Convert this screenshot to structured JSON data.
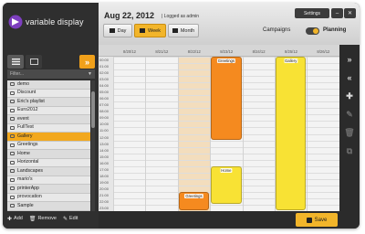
{
  "app": {
    "brand": "variable display",
    "date_title": "Aug 22, 2012",
    "logged_in": "| Logged as admin"
  },
  "window_controls": {
    "settings": "Settings",
    "minimize": "–",
    "close": "✕"
  },
  "sidebar": {
    "collapse_label": "»",
    "filter_placeholder": "Filter...",
    "items": [
      {
        "label": "demo"
      },
      {
        "label": "Discount"
      },
      {
        "label": "Eric's playlist"
      },
      {
        "label": "Euro2012"
      },
      {
        "label": "event"
      },
      {
        "label": "FullTest"
      },
      {
        "label": "Gallery"
      },
      {
        "label": "Greetings"
      },
      {
        "label": "Home"
      },
      {
        "label": "Horizontal"
      },
      {
        "label": "Landscapes"
      },
      {
        "label": "mario's"
      },
      {
        "label": "printerApp"
      },
      {
        "label": "provocation"
      },
      {
        "label": "Sample"
      }
    ],
    "selected_item": "Gallery",
    "actions": {
      "add": "Add",
      "remove": "Remove",
      "edit": "Edit"
    }
  },
  "toolbar": {
    "day": "Day",
    "week": "Week",
    "month": "Month",
    "active_range": "Week",
    "mode_left": "Campaigns",
    "mode_right": "Planning",
    "active_mode": "Planning"
  },
  "calendar": {
    "days": [
      "8/20/12",
      "8/21/12",
      "8/22/12",
      "8/23/12",
      "8/24/12",
      "8/25/12",
      "8/26/12"
    ],
    "today_index": 2,
    "times": [
      "00:00",
      "01:00",
      "02:00",
      "03:00",
      "04:00",
      "05:00",
      "06:00",
      "07:00",
      "08:00",
      "09:00",
      "10:00",
      "11:00",
      "12:00",
      "13:00",
      "14:00",
      "15:00",
      "16:00",
      "17:00",
      "18:00",
      "19:00",
      "20:00",
      "21:00",
      "22:00",
      "23:00"
    ],
    "events": [
      {
        "label": "Greetings",
        "day": 3,
        "start": 0,
        "end": 13,
        "color": "#f58a1f"
      },
      {
        "label": "Gallery",
        "day": 5,
        "start": 0,
        "end": 24,
        "color": "#f8e234"
      },
      {
        "label": "Home",
        "day": 3,
        "start": 17,
        "end": 23,
        "color": "#f8e234"
      },
      {
        "label": "Greetings",
        "day": 2,
        "start": 21,
        "end": 24,
        "color": "#f58a1f"
      }
    ]
  },
  "right_toolbar": {
    "expand": "»",
    "collapse": "«",
    "add": "✚",
    "edit": "✎",
    "delete": "🗑",
    "copy": "⧉"
  },
  "footer": {
    "save": "Save"
  },
  "colors": {
    "accent": "#f2b52a",
    "orange_event": "#f58a1f",
    "yellow_event": "#f8e234",
    "selected_row": "#f2a81e"
  }
}
